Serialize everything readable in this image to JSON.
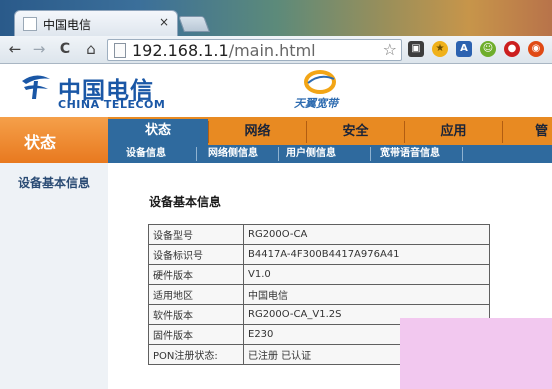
{
  "browser": {
    "tab_title": "中国电信",
    "tab_close": "×",
    "url_host": "192.168.1.1",
    "url_path": "/main.html",
    "nav": {
      "back": "←",
      "forward": "→",
      "reload": "C",
      "home": "⌂"
    },
    "bookmark_icon": "star-icon"
  },
  "header": {
    "logo_cn": "中国电信",
    "logo_en": "CHINA TELECOM",
    "brand": "天翼宽带"
  },
  "status": {
    "label": "状态"
  },
  "main_nav": {
    "items": [
      {
        "label": "状态"
      },
      {
        "label": "网络"
      },
      {
        "label": "安全"
      },
      {
        "label": "应用"
      },
      {
        "label": "管"
      }
    ],
    "active_index": 0
  },
  "sub_nav": {
    "items": [
      {
        "label": "设备信息"
      },
      {
        "label": "网络侧信息"
      },
      {
        "label": "用户侧信息"
      },
      {
        "label": "宽带语音信息"
      }
    ]
  },
  "sidebar": {
    "items": [
      {
        "label": "设备基本信息"
      }
    ]
  },
  "content": {
    "title": "设备基本信息",
    "rows": [
      {
        "label": "设备型号",
        "value": "RG200O-CA"
      },
      {
        "label": "设备标识号",
        "value": "B4417A-4F300B4417A976A41"
      },
      {
        "label": "硬件版本",
        "value": "V1.0"
      },
      {
        "label": "适用地区",
        "value": "中国电信"
      },
      {
        "label": "软件版本",
        "value": "RG200O-CA_V1.2S"
      },
      {
        "label": "固件版本",
        "value": "E230"
      },
      {
        "label": "PON注册状态:",
        "value": "已注册 已认证"
      }
    ]
  },
  "colors": {
    "orange": "#e88a22",
    "blue_nav": "#2f6a9e",
    "telecom_blue": "#1a57a6"
  }
}
